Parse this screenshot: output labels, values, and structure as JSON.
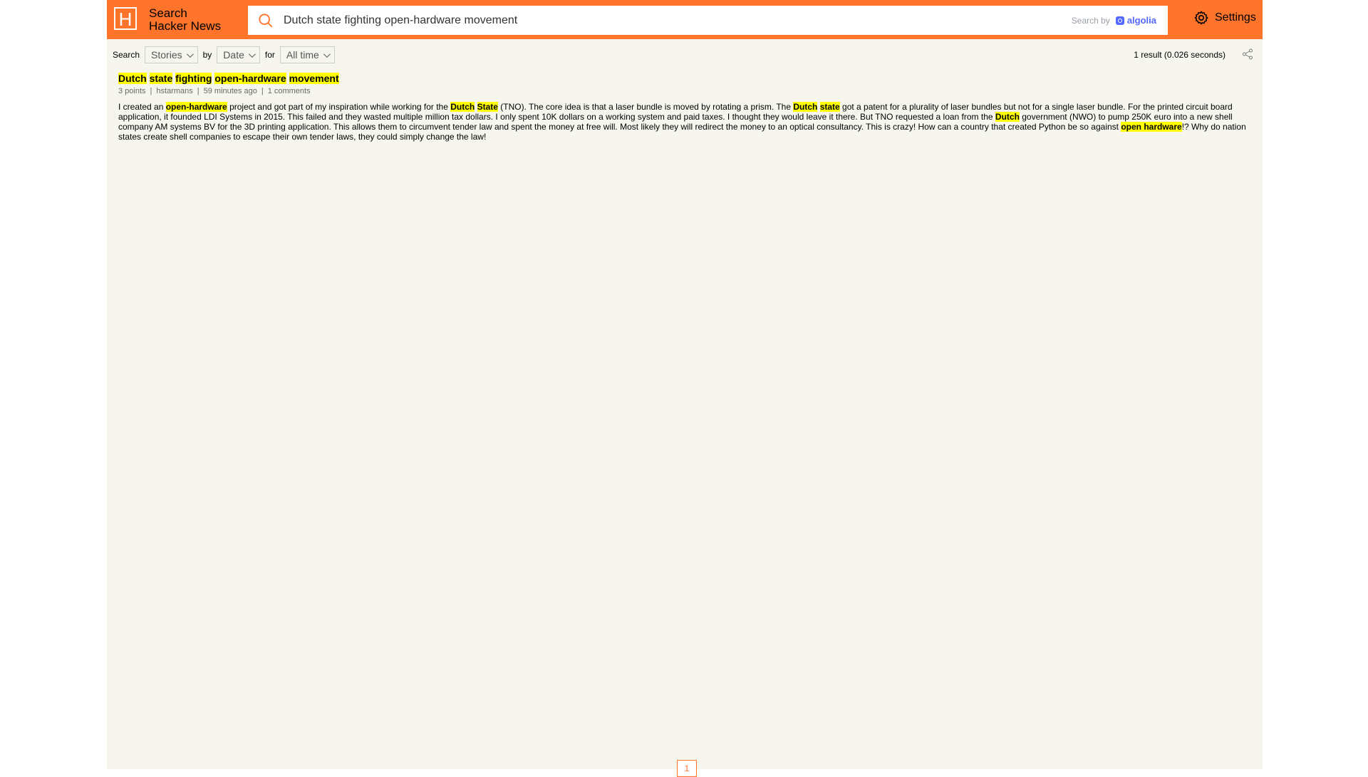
{
  "header": {
    "logo_letter": "H",
    "title_line1": "Search",
    "title_line2": "Hacker News",
    "search_value": "Dutch state fighting open-hardware movement",
    "search_by_label": "Search by",
    "algolia_label": "algolia",
    "settings_label": "Settings",
    "accent_color": "#ff742b"
  },
  "filters": {
    "search_label": "Search",
    "type_value": "Stories",
    "by_label": "by",
    "sort_value": "Date",
    "for_label": "for",
    "range_value": "All time"
  },
  "results_meta": "1 result (0.026 seconds)",
  "story": {
    "title_parts": [
      {
        "text": "Dutch",
        "hl": true
      },
      {
        "text": " ",
        "hl": false
      },
      {
        "text": "state",
        "hl": true
      },
      {
        "text": " ",
        "hl": false
      },
      {
        "text": "fighting",
        "hl": true
      },
      {
        "text": " ",
        "hl": false
      },
      {
        "text": "open-hardware",
        "hl": true
      },
      {
        "text": " ",
        "hl": false
      },
      {
        "text": "movement",
        "hl": true
      }
    ],
    "points": "3 points",
    "author": "hstarmans",
    "time": "59 minutes ago",
    "comments": "1 comments",
    "text_parts": [
      {
        "text": "I created an ",
        "hl": false
      },
      {
        "text": "open-hardware",
        "hl": true
      },
      {
        "text": " project and got part of my inspiration while working for the ",
        "hl": false
      },
      {
        "text": "Dutch",
        "hl": true
      },
      {
        "text": " ",
        "hl": false
      },
      {
        "text": "State",
        "hl": true
      },
      {
        "text": " (TNO). The core idea is that a laser bundle is moved by rotating a prism. The ",
        "hl": false
      },
      {
        "text": "Dutch",
        "hl": true
      },
      {
        "text": " ",
        "hl": false
      },
      {
        "text": "state",
        "hl": true
      },
      {
        "text": " got a patent for a plurality of laser bundles but not for a single laser bundle. For the printed circuit board application, it founded LDI Systems in 2015. This failed and they wasted multiple million tax dollars. I only spent 10K dollars on a working system and paid taxes. I thought they would leave it there. But TNO requested a loan from the ",
        "hl": false
      },
      {
        "text": "Dutch",
        "hl": true
      },
      {
        "text": " government (NWO) to pump 250K euro into a new shell company AM systems BV for the 3D printing application. This allows them to circumvent tender law and spent the money at free will. Most likely they will redirect the money to an optical consultancy. This is crazy! How can a country that created Python be so against ",
        "hl": false
      },
      {
        "text": "open hardware",
        "hl": true
      },
      {
        "text": "!? Why do nation states create shell companies to escape their own tender laws, they could simply change the law!",
        "hl": false
      }
    ]
  },
  "pagination": {
    "current_page": "1"
  }
}
